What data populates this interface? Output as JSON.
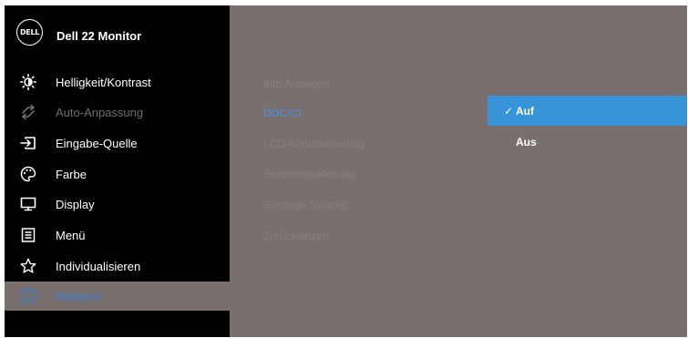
{
  "header": {
    "logo_text": "DELL",
    "title": "Dell 22 Monitor"
  },
  "menu": {
    "items": [
      {
        "label": "Helligkeit/Kontrast",
        "icon": "brightness-icon",
        "state": "normal"
      },
      {
        "label": "Auto-Anpassung",
        "icon": "auto-adjust-icon",
        "state": "disabled"
      },
      {
        "label": "Eingabe-Quelle",
        "icon": "input-source-icon",
        "state": "normal"
      },
      {
        "label": "Farbe",
        "icon": "color-palette-icon",
        "state": "normal"
      },
      {
        "label": "Display",
        "icon": "display-icon",
        "state": "normal"
      },
      {
        "label": "Menü",
        "icon": "menu-icon",
        "state": "normal"
      },
      {
        "label": "Individualisieren",
        "icon": "star-icon",
        "state": "normal"
      },
      {
        "label": "Weiteres",
        "icon": "others-icon",
        "state": "selected"
      }
    ]
  },
  "submenu": {
    "items": [
      {
        "label": "Info Anzeigen",
        "active": false
      },
      {
        "label": "DDC/CI",
        "active": true
      },
      {
        "label": "LCD-Konditionierung",
        "active": false
      },
      {
        "label": "Servicemarkierung",
        "active": false
      },
      {
        "label": "Sonstige zurücks.",
        "active": false
      },
      {
        "label": "Zurücksetzen",
        "active": false
      }
    ]
  },
  "options": {
    "check_mark": "✓",
    "items": [
      {
        "label": "Auf",
        "selected": true
      },
      {
        "label": "Aus",
        "selected": false
      }
    ]
  },
  "colors": {
    "panel_bg": "#7a6f6f",
    "sidebar_bg": "#000000",
    "accent": "#3894d9",
    "selected_text": "#3b7fd0"
  }
}
